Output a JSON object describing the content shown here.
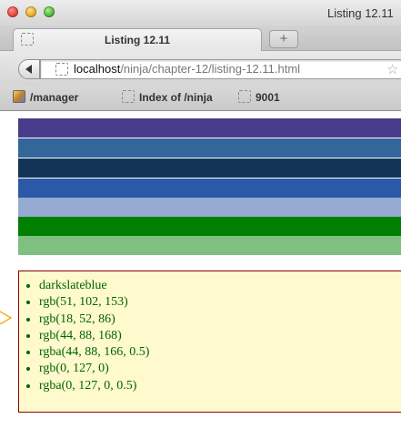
{
  "window": {
    "title": "Listing 12.11"
  },
  "tabs": [
    {
      "label": "Listing 12.11",
      "active": true
    }
  ],
  "new_tab_label": "+",
  "address": {
    "host": "localhost",
    "path": "/ninja/chapter-12/listing-12.11.html"
  },
  "bookmarks": [
    {
      "label": "/manager",
      "icon": "manager-icon"
    },
    {
      "label": "Index of /ninja",
      "icon": "page-icon"
    },
    {
      "label": "9001",
      "icon": "page-icon"
    }
  ],
  "stripes": [
    {
      "color": "#483d8b"
    },
    {
      "color": "#336699"
    },
    {
      "color": "#123456"
    },
    {
      "color": "#2c58a8"
    },
    {
      "color": "rgba(44,88,166,0.5)"
    },
    {
      "color": "#007f00"
    },
    {
      "color": "rgba(0,127,0,0.5)"
    }
  ],
  "color_list": [
    "darkslateblue",
    "rgb(51, 102, 153)",
    "rgb(18, 52, 86)",
    "rgb(44, 88, 168)",
    "rgba(44, 88, 166, 0.5)",
    "rgb(0, 127, 0)",
    "rgba(0, 127, 0, 0.5)"
  ],
  "list_style": {
    "background": "#fffacd",
    "border": "#8b0000",
    "text": "#006400"
  }
}
